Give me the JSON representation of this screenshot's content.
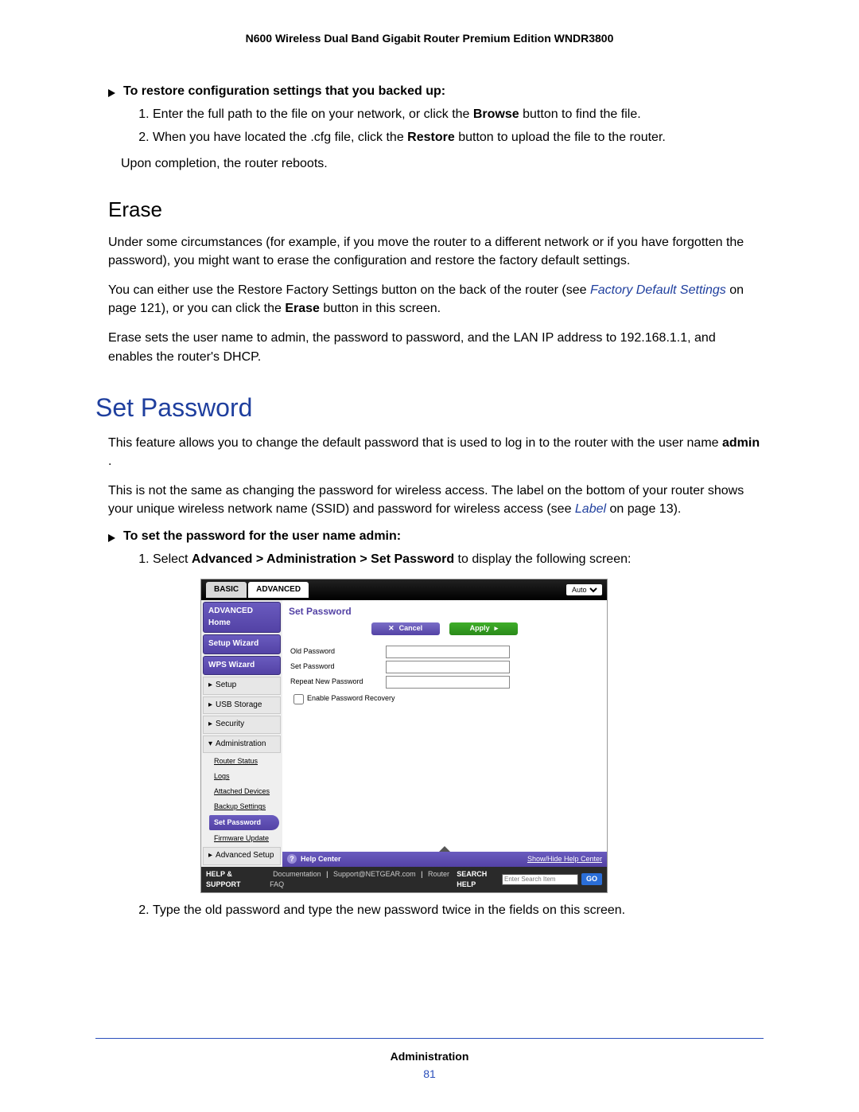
{
  "header": "N600 Wireless Dual Band Gigabit Router Premium Edition WNDR3800",
  "restore": {
    "arrow": "To restore configuration settings that you backed up:",
    "step1_a": "Enter the full path to the file on your network, or click the ",
    "step1_b": "Browse",
    "step1_c": " button to find the file.",
    "step2_a": "When you have located the .cfg file, click the ",
    "step2_b": "Restore",
    "step2_c": " button to upload the file to the router.",
    "after": "Upon completion, the router reboots."
  },
  "erase": {
    "title": "Erase",
    "p1": "Under some circumstances (for example, if you move the router to a different network or if you have forgotten the password), you might want to erase the configuration and restore the factory default settings.",
    "p2_a": "You can either use the Restore Factory Settings button on the back of the router (see ",
    "p2_link": "Factory Default Settings",
    "p2_b": " on page 121), or you can click the ",
    "p2_bold": "Erase",
    "p2_c": " button in this screen.",
    "p3": "Erase sets the user name to admin, the password to password, and the LAN IP address to 192.168.1.1, and enables the router's DHCP."
  },
  "setpw": {
    "title": "Set Password",
    "p1_a": "This feature allows you to change the default password that is used to log in to the router with the user name ",
    "p1_bold": "admin",
    "p1_b": ".",
    "p2_a": "This is not the same as changing the password for wireless access. The label on the bottom of your router shows your unique wireless network name (SSID) and password for wireless access (see ",
    "p2_link": "Label",
    "p2_b": " on page 13).",
    "arrow": "To set the password for the user name admin:",
    "step1_a": "Select ",
    "step1_bold": "Advanced > Administration > Set Password",
    "step1_b": " to display the following screen:",
    "step2": "Type the old password and type the new password twice in the fields on this screen."
  },
  "router": {
    "tab_basic": "BASIC",
    "tab_adv": "ADVANCED",
    "auto": "Auto",
    "side": {
      "adv_home": "ADVANCED Home",
      "setup_wiz": "Setup Wizard",
      "wps_wiz": "WPS Wizard",
      "setup": "Setup",
      "usb": "USB Storage",
      "security": "Security",
      "admin": "Administration",
      "sub": {
        "status": "Router Status",
        "logs": "Logs",
        "attached": "Attached Devices",
        "backup": "Backup Settings",
        "setpw": "Set Password",
        "fw": "Firmware Update"
      },
      "adv_setup": "Advanced Setup"
    },
    "main": {
      "title": "Set Password",
      "cancel": "Cancel",
      "apply": "Apply",
      "old": "Old Password",
      "new": "Set Password",
      "repeat": "Repeat New Password",
      "recover": "Enable Password Recovery",
      "help": "Help Center",
      "showhide": "Show/Hide Help Center"
    },
    "foot": {
      "hs": "HELP & SUPPORT",
      "doc": "Documentation",
      "sup": "Support@NETGEAR.com",
      "faq": "Router FAQ",
      "search_lbl": "SEARCH HELP",
      "placeholder": "Enter Search Item",
      "go": "GO"
    }
  },
  "footer": {
    "section": "Administration",
    "page": "81"
  }
}
